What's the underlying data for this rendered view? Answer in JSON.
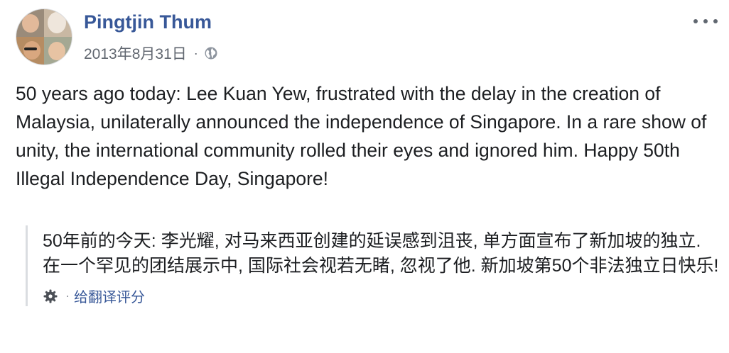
{
  "post": {
    "author": "Pingtjin Thum",
    "timestamp": "2013年8月31日",
    "separator": "·",
    "body": "50 years ago today: Lee Kuan Yew, frustrated with the delay in the creation of Malaysia, unilaterally announced the independence of Singapore. In a rare show of unity, the international community rolled their eyes and ignored him. Happy 50th Illegal Independence Day, Singapore!",
    "icons": {
      "privacy": "globe-icon",
      "menu": "more-icon"
    }
  },
  "translation": {
    "text": "50年前的今天: 李光耀, 对马来西亚创建的延误感到沮丧, 单方面宣布了新加坡的独立. 在一个罕见的团结展示中, 国际社会视若无睹, 忽视了他. 新加坡第50个非法独立日快乐!",
    "separator": "·",
    "rate_label": "给翻译评分",
    "icon": "gear-icon"
  },
  "colors": {
    "name_link": "#385898",
    "meta_text": "#616770",
    "body_text": "#1c1e21",
    "quote_border": "#dadde1"
  }
}
